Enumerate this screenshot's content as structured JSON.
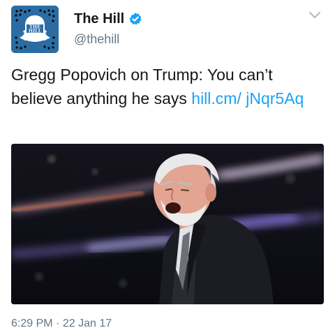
{
  "account": {
    "display_name": "The Hill",
    "handle": "@thehill",
    "avatar_text": "THE HILL",
    "verified": true
  },
  "tweet": {
    "text": "Gregg Popovich on Trump: You can’t believe anything he says ",
    "link_text": "hill.cm/ jNqr5Aq"
  },
  "meta": {
    "time": "6:29 PM",
    "separator": "·",
    "date": "22 Jan 17"
  },
  "icons": {
    "verified": "verified-badge-icon",
    "chevron": "chevron-down-icon"
  },
  "colors": {
    "accent": "#1da1f2",
    "secondary_text": "#657786",
    "avatar_bg": "#2b6da3"
  }
}
